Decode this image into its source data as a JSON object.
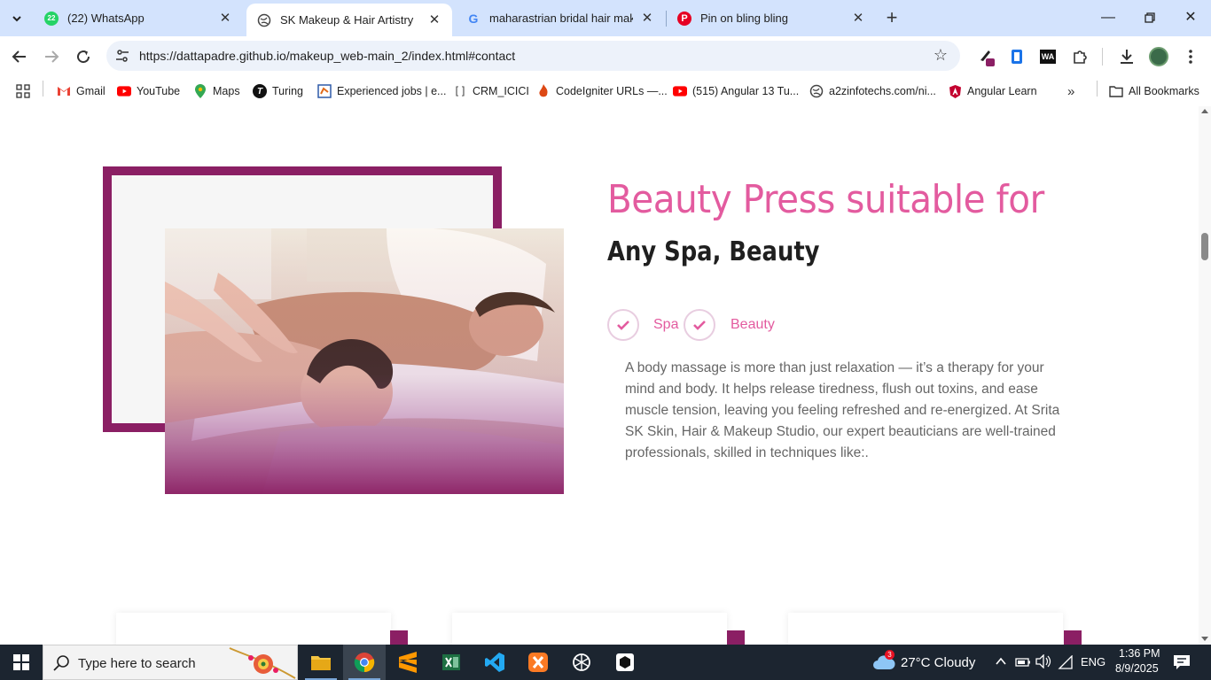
{
  "browser": {
    "tabs": [
      {
        "title": "(22) WhatsApp",
        "badge": "22"
      },
      {
        "title": "SK Makeup & Hair Artistry"
      },
      {
        "title": "maharastrian bridal hair makeup"
      },
      {
        "title": "Pin on bling bling"
      }
    ],
    "url": "https://dattapadre.github.io/makeup_web-main_2/index.html#contact",
    "bookmarks": [
      {
        "label": "Gmail"
      },
      {
        "label": "YouTube"
      },
      {
        "label": "Maps"
      },
      {
        "label": "Turing"
      },
      {
        "label": "Experienced jobs | e..."
      },
      {
        "label": "CRM_ICICI"
      },
      {
        "label": "CodeIgniter URLs —..."
      },
      {
        "label": "(515) Angular 13 Tu..."
      },
      {
        "label": "a2zinfotechs.com/ni..."
      },
      {
        "label": "Angular Learn"
      }
    ],
    "all_bookmarks_label": "All Bookmarks"
  },
  "page": {
    "headline": "Beauty Press suitable for",
    "subhead": "Any Spa, Beauty",
    "features": [
      "Spa",
      "Beauty"
    ],
    "body": "A body massage is more than just relaxation — it’s a therapy for your mind and body. It helps release tiredness, flush out toxins, and ease muscle tension, leaving you feeling refreshed and re-energized. At Srita SK Skin, Hair & Makeup Studio, our expert beauticians are well-trained professionals, skilled in techniques like:."
  },
  "taskbar": {
    "search_placeholder": "Type here to search",
    "weather": "27°C  Cloudy",
    "weather_badge": "3",
    "language": "ENG",
    "time": "1:36 PM",
    "date": "8/9/2025"
  },
  "colors": {
    "accent_pink": "#e35b9f",
    "frame_plum": "#8b1f64",
    "tabstrip": "#d3e3fd"
  }
}
